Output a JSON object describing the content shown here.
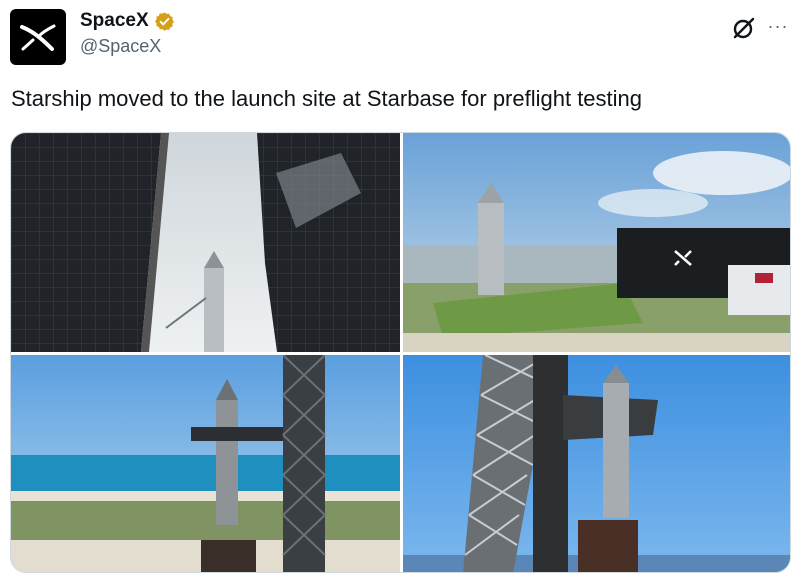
{
  "author": {
    "display_name": "SpaceX",
    "handle": "@SpaceX",
    "avatar_icon": "spacex-x-logo-icon",
    "verified_icon": "verified-badge-icon",
    "verified_color": "#d4a017"
  },
  "actions": {
    "grok_icon": "grok-icon",
    "more_label": "···"
  },
  "tweet": {
    "text": "Starship moved to the launch site at Starbase for preflight testing"
  },
  "media": {
    "images": [
      {
        "subject": "launch tower chopsticks with Starship"
      },
      {
        "subject": "Starship beside Starfactory building"
      },
      {
        "subject": "Starship at launch tower by the ocean"
      },
      {
        "subject": "Starship lifted by tower arms"
      }
    ]
  },
  "colors": {
    "text_primary": "#0f1419",
    "text_secondary": "#536471",
    "border": "#cfd9de",
    "sky_blue": "#3d8fe0"
  }
}
